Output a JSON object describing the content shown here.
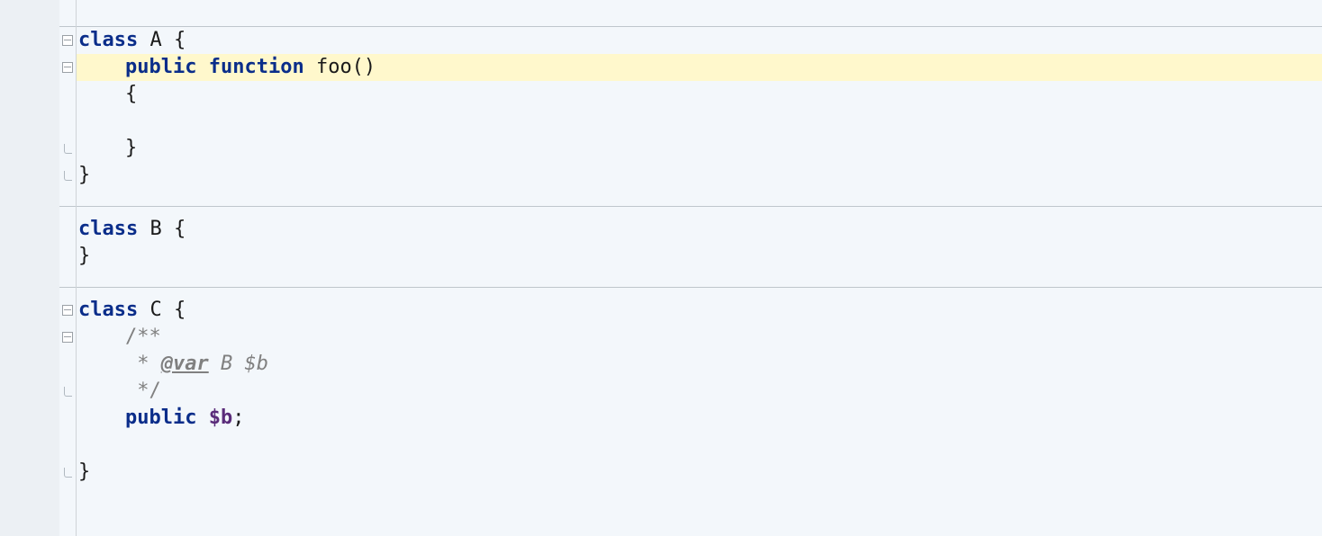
{
  "code": {
    "l1_kw1": "class",
    "l1_name": " A {",
    "l2_kw1": "public",
    "l2_kw2": " function",
    "l2_fn": " foo()",
    "l3": "{",
    "l5": "}",
    "l6": "}",
    "l8_kw1": "class",
    "l8_name": " B {",
    "l9": "}",
    "l11_kw1": "class",
    "l11_name": " C {",
    "l12": "/**",
    "l13_pre": " * ",
    "l13_tag": "@var",
    "l13_post": " B $b",
    "l14": " */",
    "l15_kw": "public ",
    "l15_var": "$b",
    "l15_semi": ";",
    "l17": "}"
  },
  "gutter": {
    "fold_minus": "fold-minus",
    "fold_end": "fold-end"
  }
}
